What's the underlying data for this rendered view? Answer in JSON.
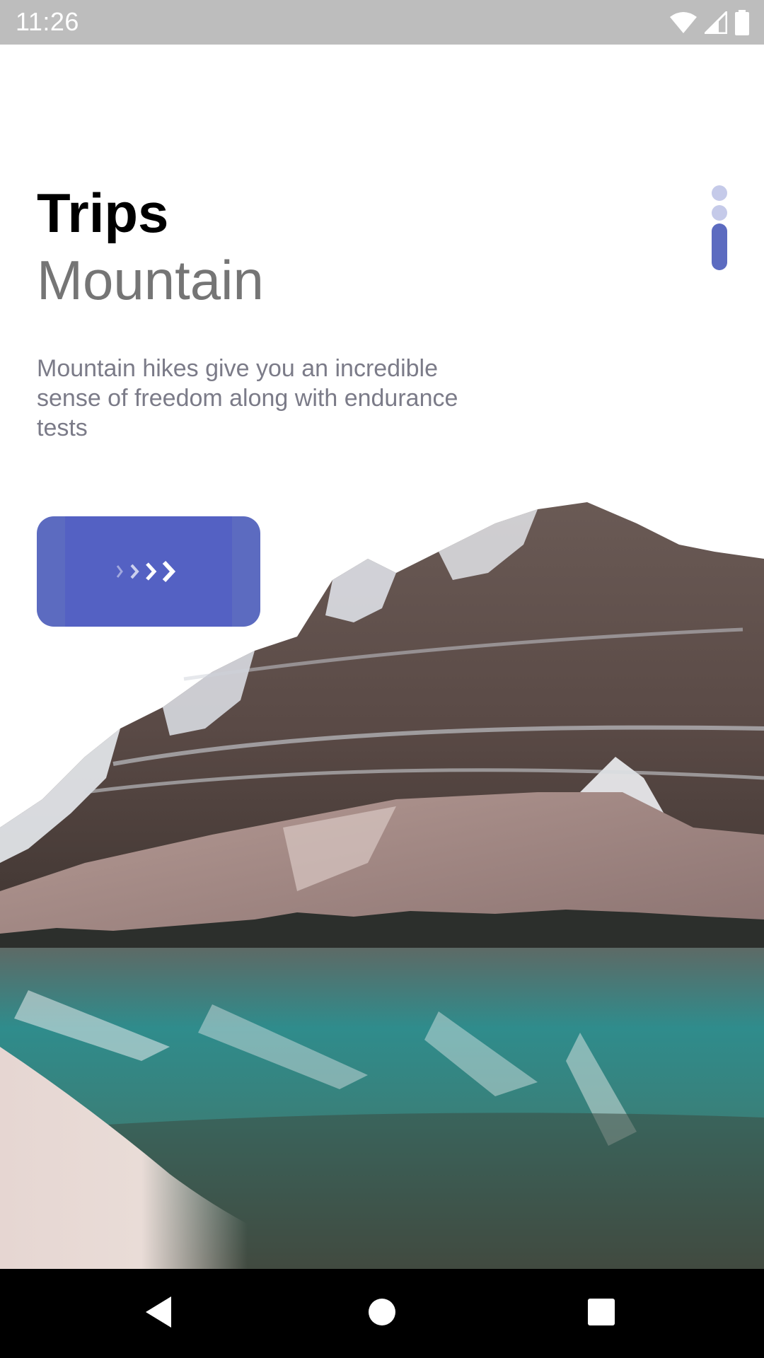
{
  "status_bar": {
    "time": "11:26",
    "icons": [
      "wifi-icon",
      "signal-icon",
      "battery-icon"
    ]
  },
  "screen": {
    "title": "Trips",
    "subtitle": "Mountain",
    "description": "Mountain hikes give you an incredible sense of freedom along with endurance tests",
    "next_button_icon": "chevrons-right-icon"
  },
  "page_indicator": {
    "total": 3,
    "active_index": 3
  },
  "nav_bar": {
    "buttons": [
      "back-icon",
      "home-icon",
      "recents-icon"
    ]
  },
  "colors": {
    "accent": "#5c6bc0",
    "indicator_inactive": "#c5cae9",
    "status_bar": "#bdbdbd",
    "subtitle": "#757575",
    "description": "#7b7b88"
  }
}
